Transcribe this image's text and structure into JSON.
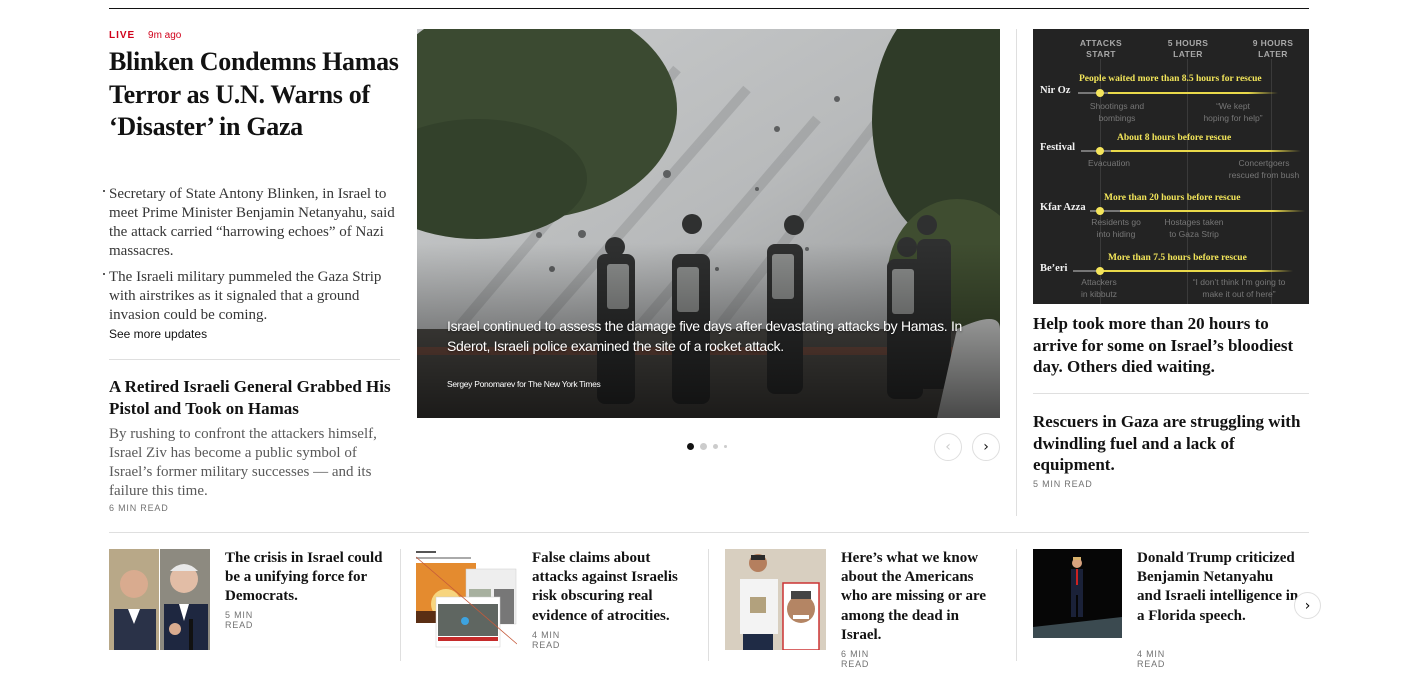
{
  "lead_story": {
    "live_label": "LIVE",
    "time_ago": "9m ago",
    "headline": "Blinken Condemns Hamas Terror as U.N. Warns of ‘Disaster’ in Gaza",
    "bullets": [
      "Secretary of State Antony Blinken, in Israel to meet Prime Minister Benjamin Netanyahu, said the attack carried “harrowing echoes” of Nazi massacres.",
      "The Israeli military pummeled the Gaza Strip with airstrikes as it signaled that a ground invasion could be coming."
    ],
    "see_more": "See more updates"
  },
  "second_story": {
    "headline": "A Retired Israeli General Grabbed His Pistol and Took on Hamas",
    "summary": "By rushing to confront the attackers himself, Israel Ziv has become a public symbol of Israel’s former military successes — and its failure this time.",
    "read_time": "6 MIN READ"
  },
  "photo": {
    "caption": "Israel continued to assess the damage five days after devastating attacks by Hamas. In Sderot, Israeli police examined the site of a rocket attack.",
    "credit": "Sergey Ponomarev for The New York Times",
    "slide_count": 4,
    "active_slide": 1,
    "prev_icon": "chevron-left-icon",
    "next_icon": "chevron-right-icon",
    "prev_glyph": "‹",
    "next_glyph": "›"
  },
  "graphic": {
    "column_heads": [
      "ATTACKS START",
      "5 HOURS LATER",
      "9 HOURS LATER"
    ],
    "col1_a": "ATTACKS",
    "col1_b": "START",
    "col2_a": "5 HOURS",
    "col2_b": "LATER",
    "col3_a": "9 HOURS",
    "col3_b": "LATER",
    "rows": [
      {
        "location": "Nir Oz",
        "label": "People waited more than 8.5 hours for rescue",
        "note_left_a": "Shootings and",
        "note_left_b": "bombings",
        "note_right_a": "“We kept",
        "note_right_b": "hoping for help”"
      },
      {
        "location": "Festival",
        "label": "About 8 hours before rescue",
        "note_left_a": "Evacuation",
        "note_left_b": "",
        "note_right_a": "Concertgoers",
        "note_right_b": "rescued from bush"
      },
      {
        "location": "Kfar Azza",
        "label": "More than 20 hours before rescue",
        "note_left_a": "Residents go",
        "note_left_b": "into hiding",
        "note_right_a": "Hostages taken",
        "note_right_b": "to Gaza Strip"
      },
      {
        "location": "Be’eri",
        "label": "More than 7.5 hours before rescue",
        "note_left_a": "Attackers",
        "note_left_b": "in kibbutz",
        "note_right_a": "“I don’t think I’m going to",
        "note_right_b": "make it out of here”"
      }
    ],
    "accent_color": "#f2e55a"
  },
  "right_stories": [
    {
      "headline": "Help took more than 20 hours to arrive for some on Israel’s bloodiest day. Others died waiting."
    },
    {
      "headline": "Rescuers in Gaza are struggling with dwindling fuel and a lack of equipment.",
      "read_time": "5 MIN READ"
    }
  ],
  "bottom_stories": [
    {
      "headline": "The crisis in Israel could be a unifying force for Democrats.",
      "read_time": "5 MIN READ"
    },
    {
      "headline": "False claims about attacks against Israelis risk obscuring real evidence of atrocities.",
      "read_time": "4 MIN READ"
    },
    {
      "headline": "Here’s what we know about the Americans who are missing or are among the dead in Israel.",
      "read_time": "6 MIN READ"
    },
    {
      "headline": "Donald Trump criticized Benjamin Netanyahu and Israeli intelligence in a Florida speech.",
      "read_time": "4 MIN READ"
    }
  ],
  "bottom_carousel": {
    "next_icon": "chevron-right-icon",
    "next_glyph": "›"
  },
  "colors": {
    "live_red": "#d0021b",
    "text": "#121212",
    "divider": "#dfdfdf"
  }
}
